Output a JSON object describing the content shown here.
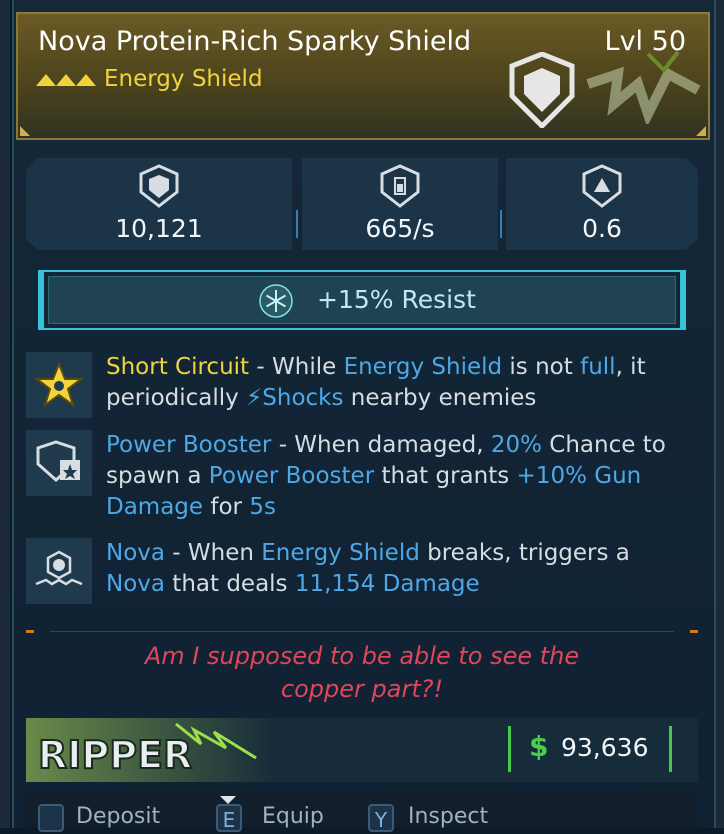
{
  "header": {
    "title": "Nova Protein-Rich Sparky Shield",
    "level": "Lvl 50",
    "subtype": "Energy Shield",
    "rarity_color": "#f2d33c"
  },
  "stats": [
    {
      "icon": "shield-capacity-icon",
      "value": "10,121"
    },
    {
      "icon": "recharge-rate-icon",
      "value": "665/s"
    },
    {
      "icon": "recharge-delay-icon",
      "value": "0.6"
    }
  ],
  "resist": {
    "icon": "cryo-snowflake-icon",
    "text": "+15% Resist"
  },
  "perks": [
    {
      "icon": "short-circuit-star-icon",
      "name": "Short Circuit",
      "t1": " - While ",
      "k1": "Energy Shield",
      "t2": " is not ",
      "k2": "full",
      "t3": ", it periodically ",
      "k3": "Shocks",
      "t4": " nearby enemies"
    },
    {
      "icon": "power-booster-icon",
      "name": "Power Booster",
      "t1": " - When damaged, ",
      "k1": "20%",
      "t2": " Chance to spawn a ",
      "k2": "Power Booster",
      "t3": " that grants ",
      "k3": "+10% Gun Damage",
      "t4": " for ",
      "k4": "5s"
    },
    {
      "icon": "nova-burst-icon",
      "name": "Nova",
      "t1": " - When ",
      "k1": "Energy Shield",
      "t2": " breaks, triggers a ",
      "k2": "Nova",
      "t3": " that deals ",
      "k3": "11,154 Damage"
    }
  ],
  "flavor": {
    "line1": "Am I supposed to be able to see the",
    "line2": "copper part?!"
  },
  "footer": {
    "manufacturer": "RIPPER",
    "currency_symbol": "$",
    "price": "93,636"
  },
  "actions": [
    {
      "key": "",
      "label": "Deposit"
    },
    {
      "key": "E",
      "label": "Equip"
    },
    {
      "key": "Y",
      "label": "Inspect"
    }
  ],
  "colors": {
    "keyword_blue": "#4fa8e6",
    "keyword_gold": "#f2d33c",
    "flavor_red": "#e0465a",
    "price_green": "#4ccd50"
  }
}
